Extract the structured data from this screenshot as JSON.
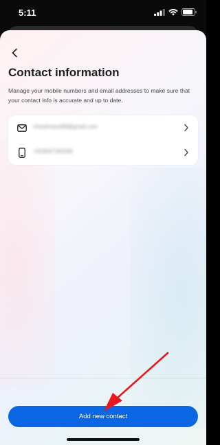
{
  "status_bar": {
    "time": "5:11"
  },
  "header": {
    "back_icon": "chevron-left-icon",
    "title": "Contact information",
    "description": "Manage your mobile numbers and email addresses to make sure that your contact info is accurate and up to date."
  },
  "contacts": [
    {
      "type": "email",
      "icon": "mail-icon",
      "value": "chiushnaus98@gmail.com"
    },
    {
      "type": "phone",
      "icon": "phone-icon",
      "value": "+919567283290"
    }
  ],
  "footer": {
    "add_button_label": "Add new contact"
  },
  "colors": {
    "primary": "#0a66e2",
    "annotation_arrow": "#e8181c"
  }
}
